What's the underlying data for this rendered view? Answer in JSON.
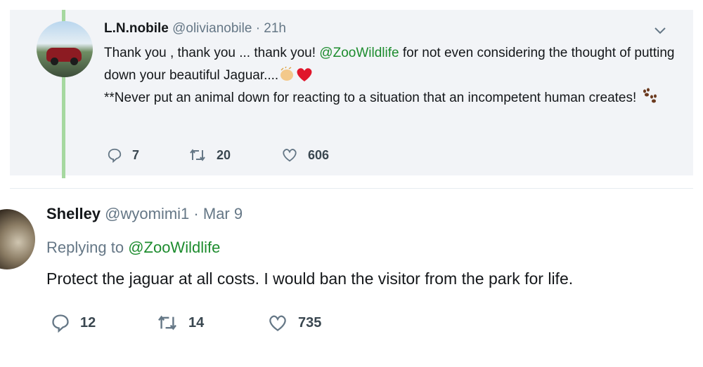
{
  "tweet_reply": {
    "name": "L.N.nobile",
    "handle": "@olivianobile",
    "separator": "·",
    "time": "21h",
    "line1_pre": "Thank you , thank you ... thank you! ",
    "mention": "@ZooWildlife",
    "line1_post": "  for not even considering the thought of putting down your beautiful Jaguar....",
    "line2": "**Never put an animal down for reacting to a situation that an incompetent human creates! ",
    "emojis": [
      "clapping-hands-icon",
      "red-heart-icon",
      "paw-prints-icon"
    ],
    "replies": "7",
    "retweets": "20",
    "likes": "606"
  },
  "tweet_main": {
    "name": "Shelley",
    "handle": "@wyomimi1",
    "separator": "·",
    "time": "Mar 9",
    "replying_label": "Replying to ",
    "replying_mention": "@ZooWildlife",
    "text": "Protect the jaguar at all costs.  I would ban the visitor from the park for life.",
    "replies": "12",
    "retweets": "14",
    "likes": "735"
  },
  "colors": {
    "mention": "#1d8c2e",
    "thread_line": "#a6d8a0",
    "reply_bg": "#f2f4f7",
    "meta": "#657786"
  }
}
